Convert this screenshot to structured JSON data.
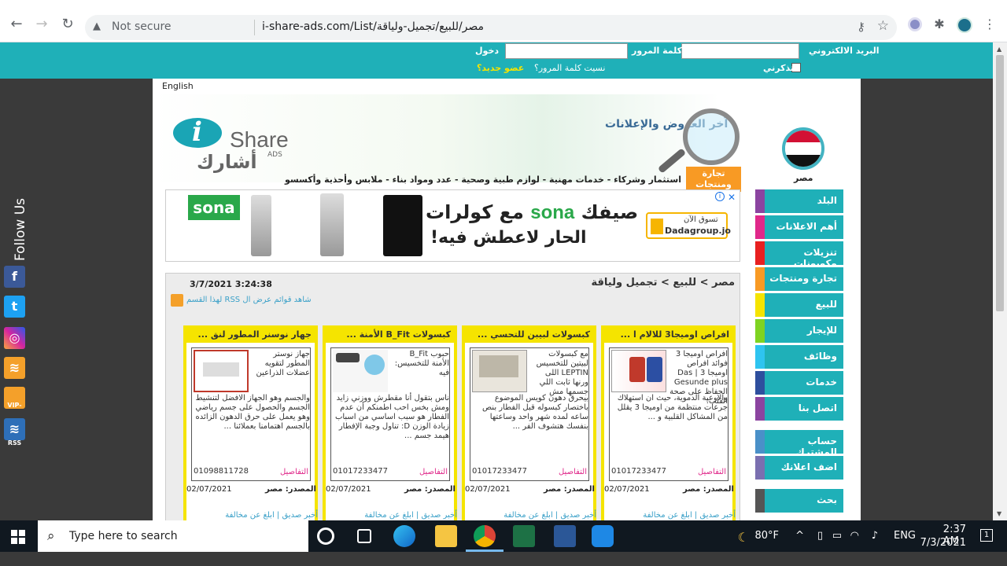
{
  "browser": {
    "security_label": "Not secure",
    "url": "i-share-ads.com/List/مصر/للبيع/تجميل-ولياقة"
  },
  "login": {
    "email_label": "البريد الالكتروني",
    "password_label": "كلمة المرور",
    "login_label": "دخول",
    "remember_label": "تذكرني",
    "forgot_label": "نسيت كلمة المرور؟",
    "new_member_label": "عضو جديد؟"
  },
  "header": {
    "language": "English",
    "logo_text": "Share",
    "logo_ads": "ADS",
    "logo_ar": "أشارك",
    "slogan": "آخر العروض والإعلانات",
    "country_label": "مصر",
    "category_tab": "تجارة ومنتجات",
    "category_links": "استثمار وشركاء  -  خدمات مهنية  -  لوازم طبية وصحية  -  عدد ومواد بناء  -  ملابس وأحذية وأكسسو"
  },
  "ad": {
    "brand": "sona",
    "headline_pre": "مع كولرات",
    "headline_brand": "sona",
    "headline_post": "صيفك",
    "subline": "الحار لاعطش فيه!",
    "dada_top": "تسوق الآن",
    "dada_name": "Dadagroup.jo",
    "close": "✕",
    "info": "i"
  },
  "content": {
    "breadcrumb": "مصر > للبيع > تجميل ولياقة",
    "datetime": "3/7/2021 3:24:38",
    "rss_text": "شاهد قوائم عرض ال RSS لهذا القسم"
  },
  "cards": [
    {
      "title": "افراص اوميجا3 للالام ا ...",
      "desc": "افراص اوميجا 3 فوائد افراص اوميجا 3 | Das Gesunde plus الحفاظ على صحة القلب:",
      "desc2": "والاوعية الدموية، حيث ان استهلاك جرعات منتظمة من اوميجا 3 يقلل من المشاكل القلبية و ...",
      "phone": "01017233477",
      "details": "التفاصيل",
      "source_label": "المصدر: مصر",
      "date": "02/07/2021",
      "links": "أخبر صديق  |  ابلغ عن مخالفة"
    },
    {
      "title": "كبسولات لبيبن للتحسي ...",
      "desc": "مع كبسولات لبيتين للتخسيس LEPTIN اللى ورنها ثابت اللي جسمها مش",
      "desc2": "بيحرق دهون كويس الموضوع باختصار كبسوله قبل الفطار بنص ساعه لمده شهر واحد وساعتها بنفسك هتشوف الفر ...",
      "phone": "01017233477",
      "details": "التفاصيل",
      "source_label": "المصدر: مصر",
      "date": "02/07/2021",
      "links": "أخبر صديق  |  ابلغ عن مخالفة"
    },
    {
      "title": "كبسولات B_Fit الأمنة ...",
      "desc": "حبوب B_Fit الأمنة للتخسيس: فيه",
      "desc2": "ناس بتقول أنا مقطرش ووزني زايد ومش بخس احب اطمنكم أن عدم الفطار هو سبب اساسي من اسباب زيادة الوزن D: تناول وجبة الإفطار هيمد جسم ...",
      "phone": "01017233477",
      "details": "التفاصيل",
      "source_label": "المصدر: مصر",
      "date": "02/07/2021",
      "links": "أخبر صديق  |  ابلغ عن مخالفة"
    },
    {
      "title": "جهار نوسنر المطور لنق ...",
      "desc": "جهاز نوستر المطور لتقويه عضلات الذراعين",
      "desc2": "والجسم وهو الجهاز الافضل لتنشيط الجسم والحصول على جسم رياضي وهو يعمل على حرق الدهون الزائده بالجسم اهتمامنا بعملائنا ...",
      "phone": "01098811728",
      "details": "التفاصيل",
      "source_label": "المصدر: مصر",
      "date": "02/07/2021",
      "links": "أخبر صديق  |  ابلغ عن مخالفة"
    }
  ],
  "menu": [
    {
      "label": "البلد",
      "color": "#8b44a0"
    },
    {
      "label": "أهم الاعلانات",
      "color": "#e0288a"
    },
    {
      "label": "تنزيلات وكوبونات",
      "color": "#e82020"
    },
    {
      "label": "تجارة ومنتجات",
      "color": "#f89a24"
    },
    {
      "label": "للبيع",
      "color": "#f5e400"
    },
    {
      "label": "للإيجار",
      "color": "#7ed321"
    },
    {
      "label": "وظائف",
      "color": "#2ec4f0"
    },
    {
      "label": "خدمات",
      "color": "#2e4f9e"
    },
    {
      "label": "اتصل بنا",
      "color": "#8b44a0"
    },
    {
      "label": "حساب المشترك",
      "color": "#4a90c8"
    },
    {
      "label": "اضف اعلانك",
      "color": "#7a6fb0"
    },
    {
      "label": "بحث",
      "color": "#555555"
    }
  ],
  "follow": {
    "label": "Follow Us",
    "vip_label": "VIP-RSS"
  },
  "taskbar": {
    "search_placeholder": "Type here to search",
    "weather": "80°F",
    "lang": "ENG",
    "time": "2:37 AM",
    "date": "7/3/2021",
    "notif_count": "1"
  }
}
